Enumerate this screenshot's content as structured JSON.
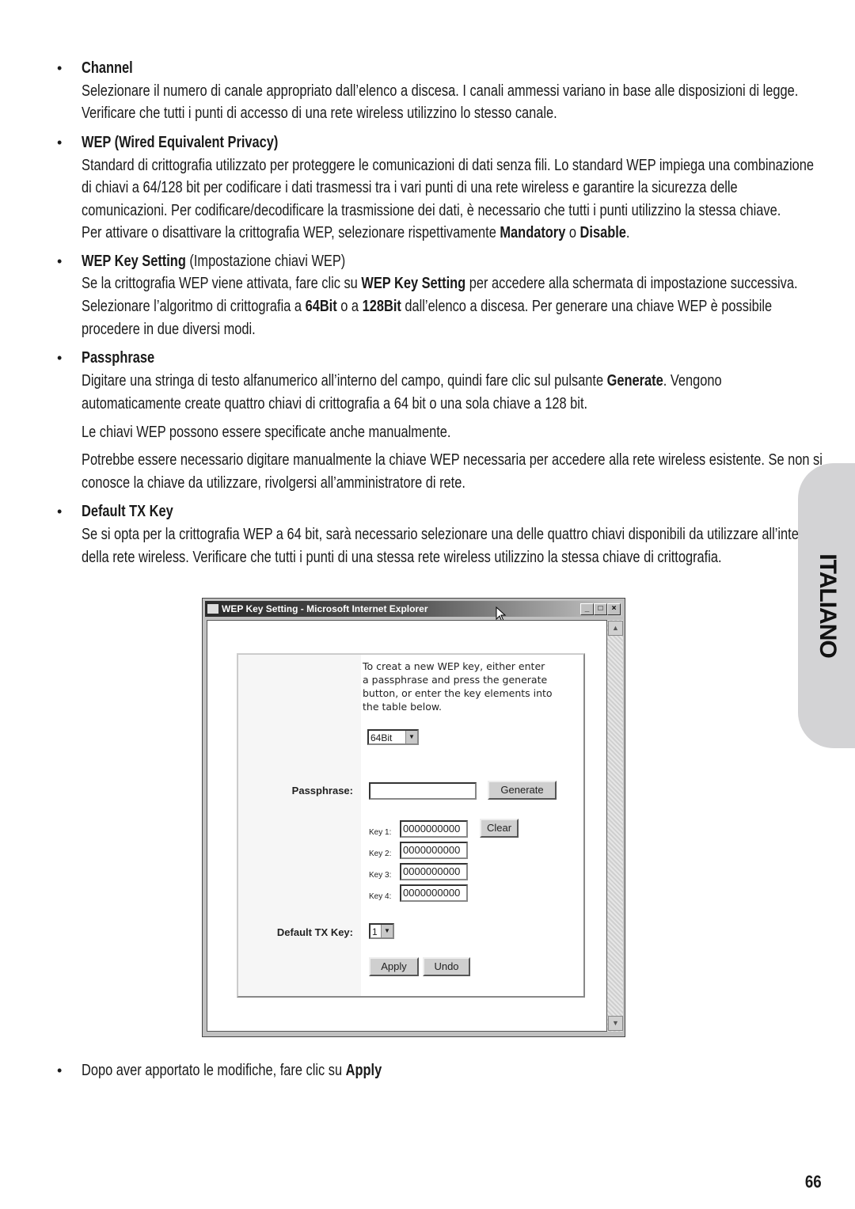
{
  "sections": {
    "channel": {
      "heading": "Channel",
      "lines": [
        "Selezionare il numero di canale appropriato dall’elenco a discesa. I canali ammessi variano in base alle disposizioni di legge.",
        "Verificare che tutti i punti di accesso di una rete wireless utilizzino lo stesso canale."
      ]
    },
    "wep": {
      "heading": "WEP (Wired Equivalent Privacy)",
      "lines": [
        "Standard di crittografia utilizzato per proteggere le comunicazioni di dati senza fili. Lo standard WEP impiega una combinazione",
        "di chiavi a 64/128 bit per codificare i dati trasmessi tra i vari punti di una rete wireless e garantire la sicurezza delle",
        "comunicazioni. Per codificare/decodificare la trasmissione dei dati, è necessario che tutti i punti utilizzino la stessa chiave."
      ],
      "line4_a": "Per attivare o disattivare la crittografia WEP, selezionare rispettivamente ",
      "line4_b": "Mandatory",
      "line4_c": " o ",
      "line4_d": "Disable",
      "line4_e": "."
    },
    "wep_key": {
      "heading_bold": "WEP Key Setting",
      "heading_rest": " (Impostazione chiavi WEP)",
      "l1_a": "Se la crittografia WEP viene attivata, fare clic su ",
      "l1_b": "WEP Key Setting",
      "l1_c": " per accedere alla schermata di impostazione successiva.",
      "l2_a": "Selezionare l’algoritmo di crittografia a ",
      "l2_b": "64Bit",
      "l2_c": " o a ",
      "l2_d": "128Bit",
      "l2_e": " dall’elenco a discesa. Per generare una chiave WEP è possibile",
      "l3": "procedere in due diversi modi."
    },
    "passphrase": {
      "heading": "Passphrase",
      "l1_a": "Digitare una stringa di testo alfanumerico all’interno del campo, quindi fare clic sul pulsante ",
      "l1_b": "Generate",
      "l1_c": ". Vengono",
      "l2": "automaticamente create quattro chiavi di crittografia a 64 bit o una sola chiave a 128 bit.",
      "p2": "Le chiavi WEP possono essere specificate anche manualmente.",
      "p3_l1": "Potrebbe essere necessario digitare manualmente la chiave WEP necessaria per accedere alla rete wireless esistente. Se non si",
      "p3_l2": "conosce la chiave da utilizzare, rivolgersi all’amministratore di rete."
    },
    "default_tx": {
      "heading": "Default TX Key",
      "l1": "Se si opta per la crittografia WEP a 64 bit, sarà necessario selezionare una delle quattro chiavi disponibili da utilizzare all’interno",
      "l2": "della rete wireless. Verificare che tutti i punti di una stessa rete wireless utilizzino la stessa chiave di crittografia."
    },
    "final": {
      "text": "Dopo aver apportato le modifiche, fare clic su ",
      "bold": "Apply"
    }
  },
  "bullet": "•",
  "side_tab": "ITALIANO",
  "page_number": "66",
  "screenshot": {
    "window_title": "WEP Key Setting - Microsoft Internet Explorer",
    "controls": {
      "minimize": "_",
      "maximize": "□",
      "close": "×"
    },
    "intro": "To creat a new WEP key, either enter\na passphrase and press the generate\nbutton, or enter the key elements into\nthe table below.",
    "bit_select": "64Bit",
    "passphrase_label": "Passphrase:",
    "passphrase_value": "",
    "generate": "Generate",
    "keys": [
      {
        "label": "Key 1:",
        "value": "0000000000"
      },
      {
        "label": "Key 2:",
        "value": "0000000000"
      },
      {
        "label": "Key 3:",
        "value": "0000000000"
      },
      {
        "label": "Key 4:",
        "value": "0000000000"
      }
    ],
    "clear": "Clear",
    "default_tx_label": "Default TX Key:",
    "default_tx_value": "1",
    "apply": "Apply",
    "undo": "Undo"
  }
}
